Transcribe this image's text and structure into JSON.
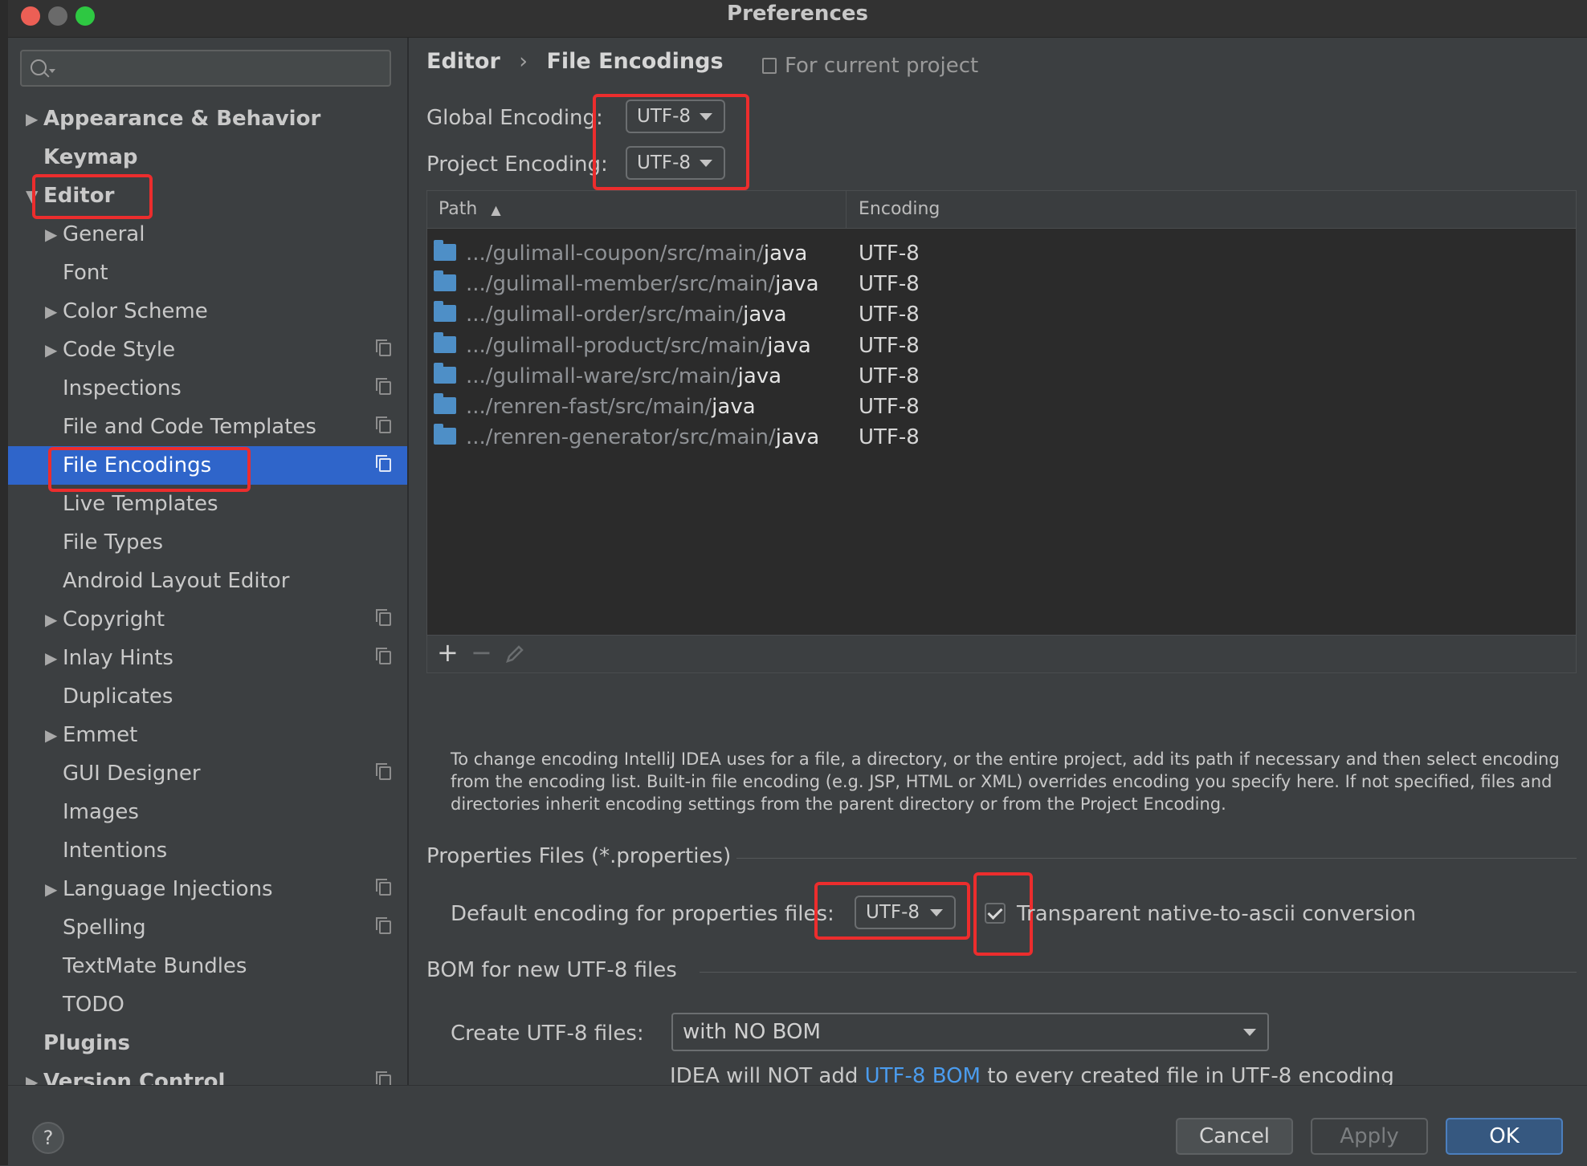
{
  "window": {
    "title": "Preferences",
    "traffic_lights": {
      "close": "#ec5f55",
      "minimize": "#6a6a6a",
      "maximize": "#2ec842"
    }
  },
  "search": {
    "placeholder": ""
  },
  "sidebar": {
    "items": [
      {
        "label": "Appearance & Behavior",
        "arrow": "▶",
        "level": 0,
        "bold": true
      },
      {
        "label": "Keymap",
        "arrow": "",
        "level": 0,
        "bold": true
      },
      {
        "label": "Editor",
        "arrow": "▼",
        "level": 0,
        "bold": true
      },
      {
        "label": "General",
        "arrow": "▶",
        "level": 1
      },
      {
        "label": "Font",
        "arrow": "",
        "level": 1
      },
      {
        "label": "Color Scheme",
        "arrow": "▶",
        "level": 1
      },
      {
        "label": "Code Style",
        "arrow": "▶",
        "level": 1,
        "project": true
      },
      {
        "label": "Inspections",
        "arrow": "",
        "level": 1,
        "project": true
      },
      {
        "label": "File and Code Templates",
        "arrow": "",
        "level": 1,
        "project": true
      },
      {
        "label": "File Encodings",
        "arrow": "",
        "level": 1,
        "project": true,
        "selected": true
      },
      {
        "label": "Live Templates",
        "arrow": "",
        "level": 1
      },
      {
        "label": "File Types",
        "arrow": "",
        "level": 1
      },
      {
        "label": "Android Layout Editor",
        "arrow": "",
        "level": 1
      },
      {
        "label": "Copyright",
        "arrow": "▶",
        "level": 1,
        "project": true
      },
      {
        "label": "Inlay Hints",
        "arrow": "▶",
        "level": 1,
        "project": true
      },
      {
        "label": "Duplicates",
        "arrow": "",
        "level": 1
      },
      {
        "label": "Emmet",
        "arrow": "▶",
        "level": 1
      },
      {
        "label": "GUI Designer",
        "arrow": "",
        "level": 1,
        "project": true
      },
      {
        "label": "Images",
        "arrow": "",
        "level": 1
      },
      {
        "label": "Intentions",
        "arrow": "",
        "level": 1
      },
      {
        "label": "Language Injections",
        "arrow": "▶",
        "level": 1,
        "project": true
      },
      {
        "label": "Spelling",
        "arrow": "",
        "level": 1,
        "project": true
      },
      {
        "label": "TextMate Bundles",
        "arrow": "",
        "level": 1
      },
      {
        "label": "TODO",
        "arrow": "",
        "level": 1
      },
      {
        "label": "Plugins",
        "arrow": "",
        "level": 0,
        "bold": true
      },
      {
        "label": "Version Control",
        "arrow": "▶",
        "level": 0,
        "bold": true,
        "project": true
      }
    ]
  },
  "main": {
    "breadcrumb": {
      "parent": "Editor",
      "separator": "›",
      "current": "File Encodings"
    },
    "scope_note": "For current project",
    "global_encoding": {
      "label": "Global Encoding:",
      "value": "UTF-8"
    },
    "project_encoding": {
      "label": "Project Encoding:",
      "value": "UTF-8"
    },
    "table": {
      "columns": [
        "Path",
        "Encoding"
      ],
      "sort_indicator": "▲",
      "rows": [
        {
          "prefix": ".../gulimall-coupon/src/main/",
          "dir": "java",
          "encoding": "UTF-8"
        },
        {
          "prefix": ".../gulimall-member/src/main/",
          "dir": "java",
          "encoding": "UTF-8"
        },
        {
          "prefix": ".../gulimall-order/src/main/",
          "dir": "java",
          "encoding": "UTF-8"
        },
        {
          "prefix": ".../gulimall-product/src/main/",
          "dir": "java",
          "encoding": "UTF-8"
        },
        {
          "prefix": ".../gulimall-ware/src/main/",
          "dir": "java",
          "encoding": "UTF-8"
        },
        {
          "prefix": ".../renren-fast/src/main/",
          "dir": "java",
          "encoding": "UTF-8"
        },
        {
          "prefix": ".../renren-generator/src/main/",
          "dir": "java",
          "encoding": "UTF-8"
        }
      ],
      "toolbar": {
        "add": "+",
        "remove": "−"
      }
    },
    "help_text": "To change encoding IntelliJ IDEA uses for a file, a directory, or the entire project, add its path if necessary and then select encoding from the encoding list. Built-in file encoding (e.g. JSP, HTML or XML) overrides encoding you specify here. If not specified, files and directories inherit encoding settings from the parent directory or from the Project Encoding.",
    "properties": {
      "section_title": "Properties Files (*.properties)",
      "default_label": "Default encoding for properties files:",
      "default_value": "UTF-8",
      "transparent_label": "Transparent native-to-ascii conversion",
      "transparent_checked": true
    },
    "bom": {
      "section_title": "BOM for new UTF-8 files",
      "create_label": "Create UTF-8 files:",
      "create_value": "with NO BOM",
      "note_prefix": "IDEA will NOT add ",
      "note_link": "UTF-8 BOM",
      "note_suffix": " to every created file in UTF-8 encoding"
    }
  },
  "footer": {
    "help": "?",
    "cancel": "Cancel",
    "apply": "Apply",
    "ok": "OK"
  },
  "annotation_color": "#ec2d2d"
}
